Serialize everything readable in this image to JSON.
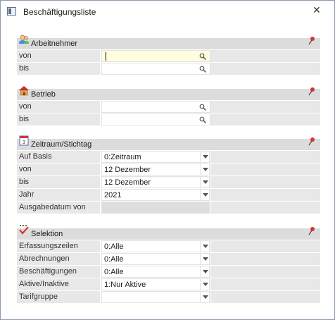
{
  "window": {
    "title": "Beschäftigungsliste",
    "close": "✕"
  },
  "arbeitnehmer": {
    "title": "Arbeitnehmer",
    "rows": [
      {
        "label": "von",
        "value": ""
      },
      {
        "label": "bis",
        "value": ""
      }
    ]
  },
  "betrieb": {
    "title": "Betrieb",
    "rows": [
      {
        "label": "von",
        "value": ""
      },
      {
        "label": "bis",
        "value": ""
      }
    ]
  },
  "zeitraum": {
    "title": "Zeitraum/Stichtag",
    "rows": [
      {
        "label": "Auf Basis",
        "value": "0:Zeitraum"
      },
      {
        "label": "von",
        "value": "12 Dezember"
      },
      {
        "label": "bis",
        "value": "12 Dezember"
      },
      {
        "label": "Jahr",
        "value": "2021"
      },
      {
        "label": "Ausgabedatum von",
        "value": ""
      }
    ]
  },
  "selektion": {
    "title": "Selektion",
    "rows": [
      {
        "label": "Erfassungszeilen",
        "value": "0:Alle"
      },
      {
        "label": "Abrechnungen",
        "value": "0:Alle"
      },
      {
        "label": "Beschäftigungen",
        "value": "0:Alle"
      },
      {
        "label": "Aktive/Inaktive",
        "value": "1:Nur Aktive"
      },
      {
        "label": "Tarifgruppe",
        "value": ""
      }
    ]
  }
}
